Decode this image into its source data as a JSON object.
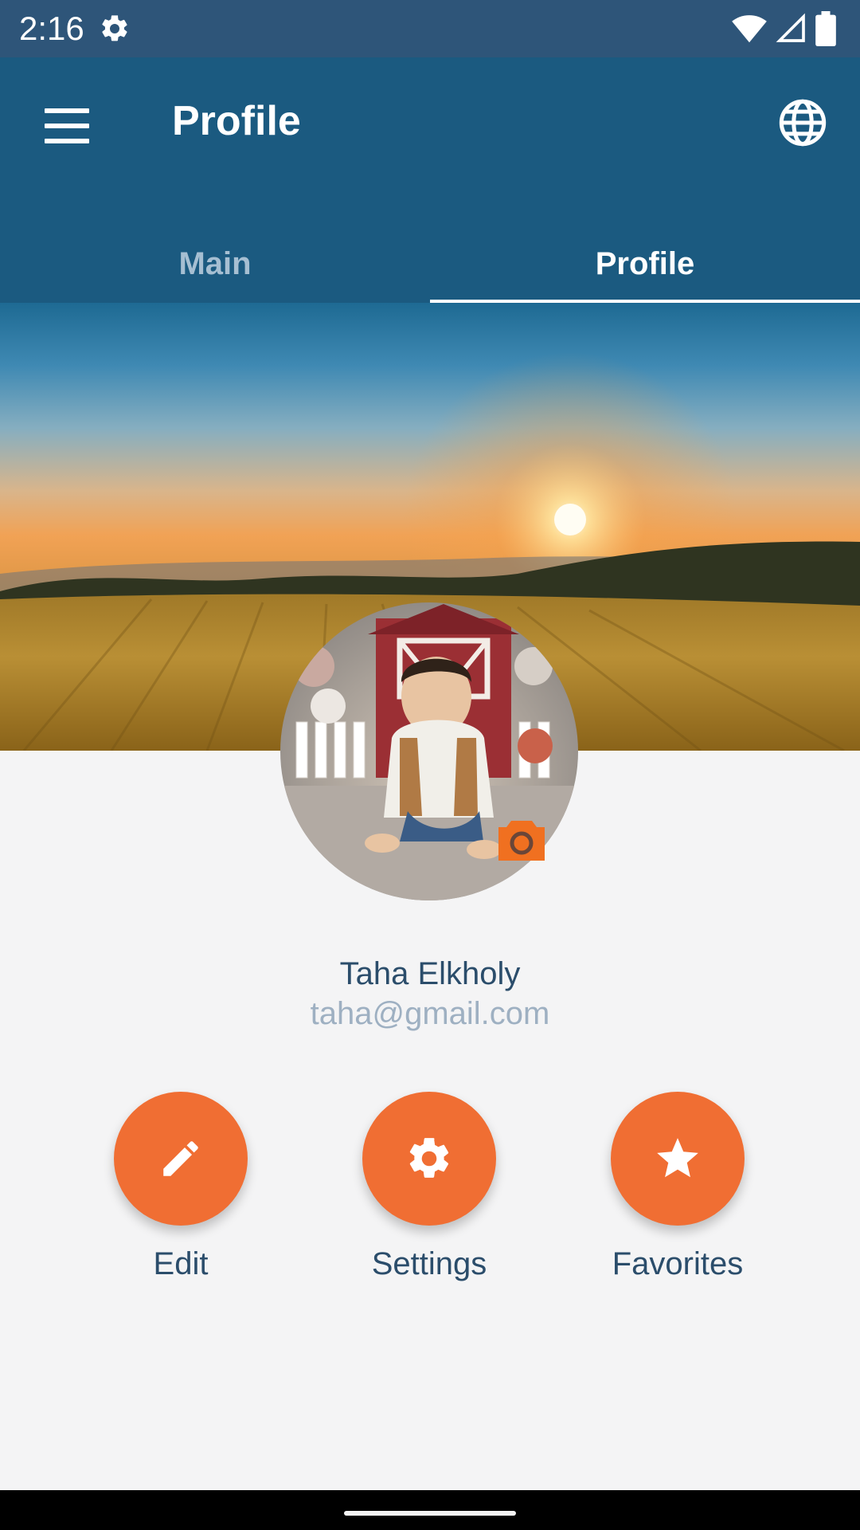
{
  "status_bar": {
    "time": "2:16"
  },
  "app_bar": {
    "title": "Profile"
  },
  "tabs": [
    {
      "label": "Main",
      "selected": false
    },
    {
      "label": "Profile",
      "selected": true
    }
  ],
  "profile": {
    "name": "Taha Elkholy",
    "email": "taha@gmail.com"
  },
  "actions": [
    {
      "label": "Edit",
      "icon": "pencil-icon"
    },
    {
      "label": "Settings",
      "icon": "gear-icon"
    },
    {
      "label": "Favorites",
      "icon": "star-icon"
    }
  ],
  "colors": {
    "status_bar": "#2e5579",
    "app_bar": "#1b5a80",
    "accent": "#f06e33",
    "text": "#2b4d6b",
    "email_text": "#9eb0c2",
    "background": "#f4f4f5"
  }
}
